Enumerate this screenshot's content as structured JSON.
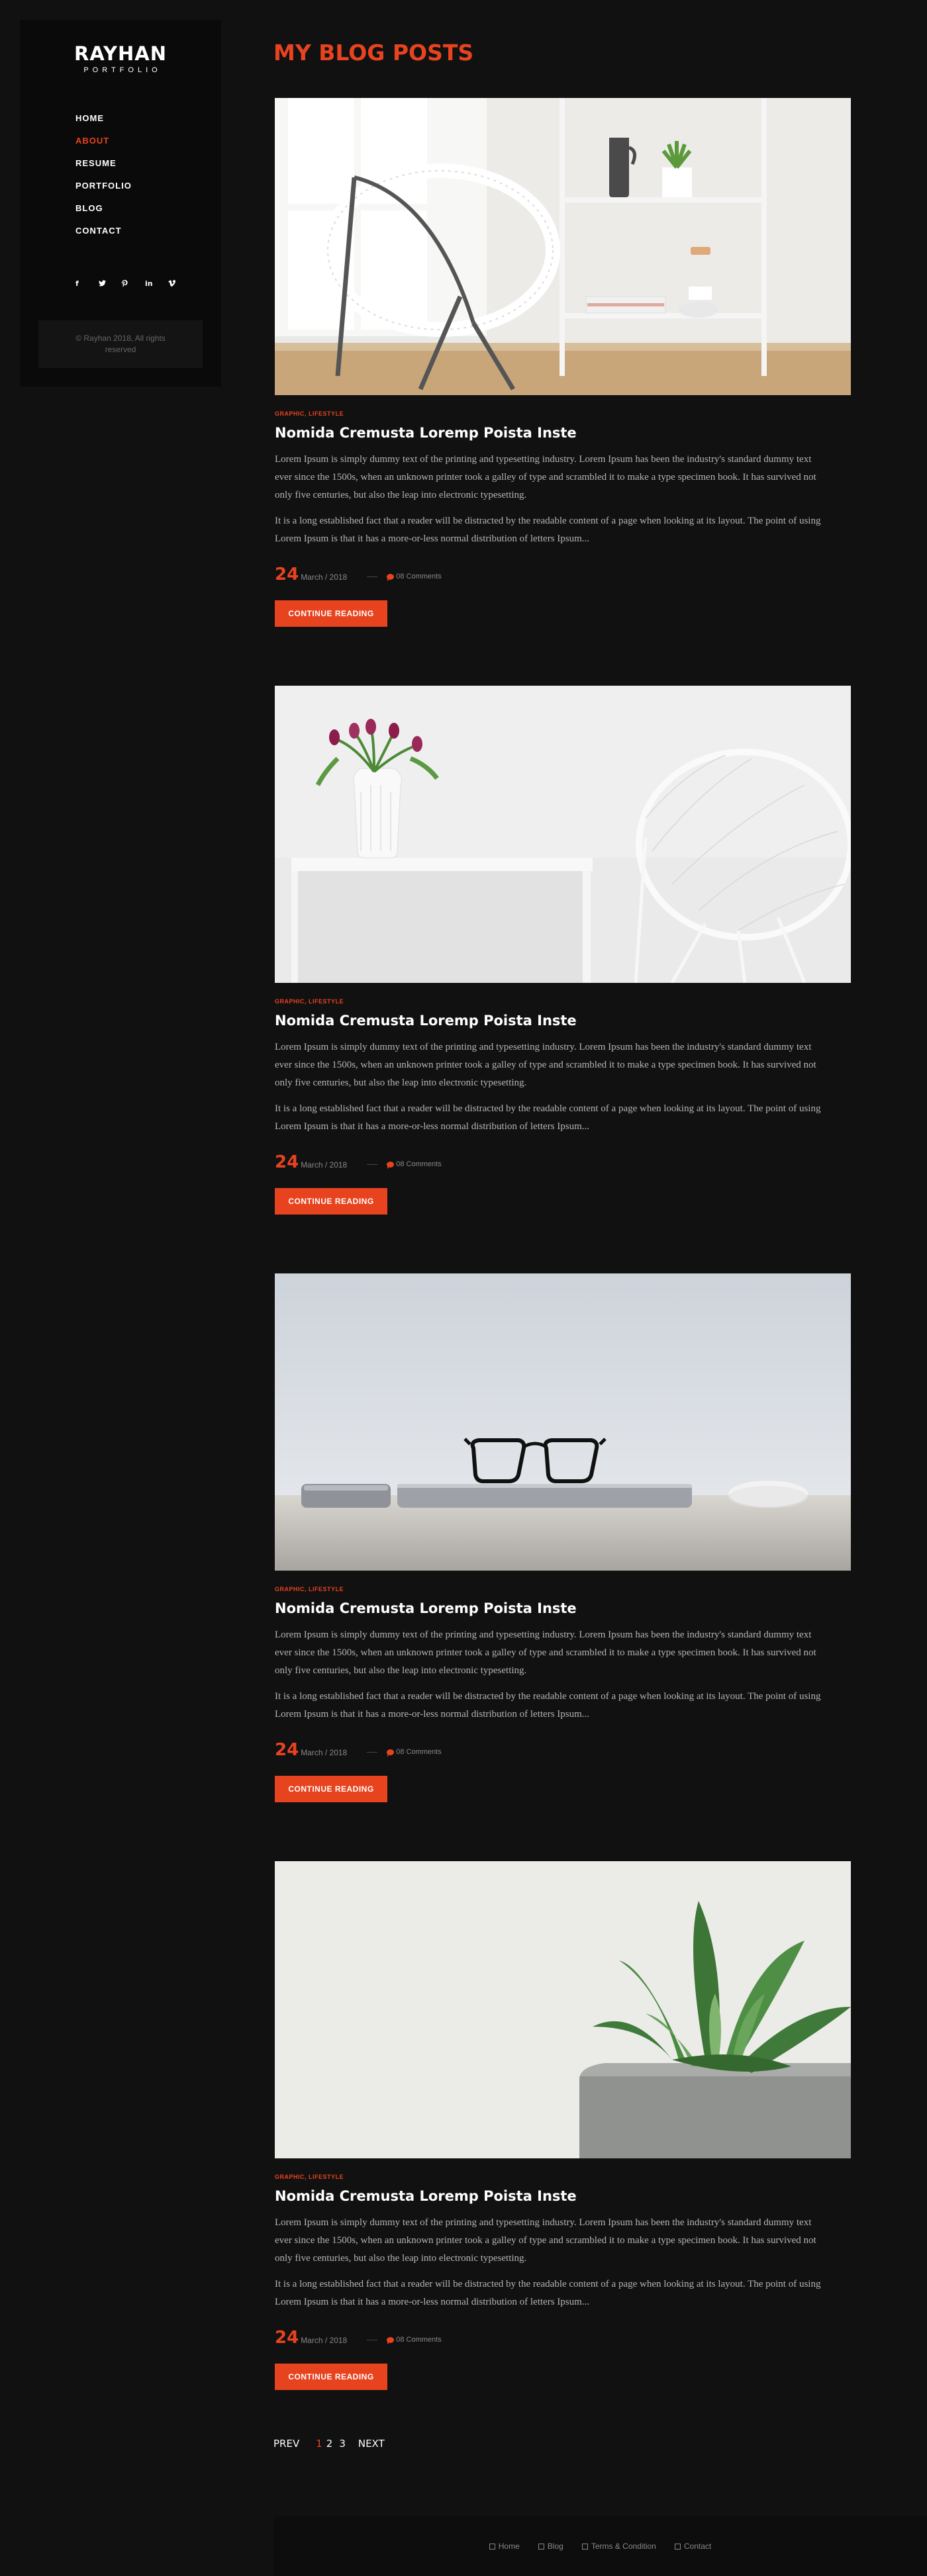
{
  "sidebar": {
    "brand": "RAYHAN",
    "brand_sub": "PORTFOLIO",
    "nav": [
      "HOME",
      "ABOUT",
      "RESUME",
      "PORTFOLIO",
      "BLOG",
      "CONTACT"
    ],
    "active_nav": "ABOUT",
    "social": [
      {
        "icon": "facebook-icon",
        "glyph": "f"
      },
      {
        "icon": "twitter-icon",
        "glyph": "t"
      },
      {
        "icon": "pinterest-icon",
        "glyph": "p"
      },
      {
        "icon": "linkedin-icon",
        "glyph": "in"
      },
      {
        "icon": "vimeo-icon",
        "glyph": "v"
      }
    ],
    "copyright": "© Rayhan 2018, All rights reserved"
  },
  "page_title": "MY BLOG POSTS",
  "posts": [
    {
      "image": "chair-and-shelf-photo",
      "category": "GRAPHIC, LIFESTYLE",
      "title": "Nomida Cremusta Loremp Poista Inste",
      "excerpt1": "Lorem Ipsum is simply dummy text of the printing and typesetting industry. Lorem Ipsum has been the industry's standard dummy text ever since the 1500s, when an unknown printer took a galley of type and scrambled it to make a type specimen book. It has survived not only five centuries, but also the leap into electronic typesetting.",
      "excerpt2": "It is a long established fact that a reader will be distracted by the readable content of a page when looking at its layout. The point of using Lorem Ipsum is that it has a more-or-less normal distribution of letters Ipsum...",
      "day": "24",
      "month": "March / 2018",
      "comments": "08 Comments",
      "button": "CONTINUE READING"
    },
    {
      "image": "tulips-and-chair-photo",
      "category": "GRAPHIC, LIFESTYLE",
      "title": "Nomida Cremusta Loremp Poista Inste",
      "excerpt1": "Lorem Ipsum is simply dummy text of the printing and typesetting industry. Lorem Ipsum has been the industry's standard dummy text ever since the 1500s, when an unknown printer took a galley of type and scrambled it to make a type specimen book. It has survived not only five centuries, but also the leap into electronic typesetting.",
      "excerpt2": "It is a long established fact that a reader will be distracted by the readable content of a page when looking at its layout. The point of using Lorem Ipsum is that it has a more-or-less normal distribution of letters Ipsum...",
      "day": "24",
      "month": "March / 2018",
      "comments": "08 Comments",
      "button": "CONTINUE READING"
    },
    {
      "image": "glasses-on-laptop-photo",
      "category": "GRAPHIC, LIFESTYLE",
      "title": "Nomida Cremusta Loremp Poista Inste",
      "excerpt1": "Lorem Ipsum is simply dummy text of the printing and typesetting industry. Lorem Ipsum has been the industry's standard dummy text ever since the 1500s, when an unknown printer took a galley of type and scrambled it to make a type specimen book. It has survived not only five centuries, but also the leap into electronic typesetting.",
      "excerpt2": "It is a long established fact that a reader will be distracted by the readable content of a page when looking at its layout. The point of using Lorem Ipsum is that it has a more-or-less normal distribution of letters Ipsum...",
      "day": "24",
      "month": "March / 2018",
      "comments": "08 Comments",
      "button": "CONTINUE READING"
    },
    {
      "image": "succulent-plant-photo",
      "category": "GRAPHIC, LIFESTYLE",
      "title": "Nomida Cremusta Loremp Poista Inste",
      "excerpt1": "Lorem Ipsum is simply dummy text of the printing and typesetting industry. Lorem Ipsum has been the industry's standard dummy text ever since the 1500s, when an unknown printer took a galley of type and scrambled it to make a type specimen book. It has survived not only five centuries, but also the leap into electronic typesetting.",
      "excerpt2": "It is a long established fact that a reader will be distracted by the readable content of a page when looking at its layout. The point of using Lorem Ipsum is that it has a more-or-less normal distribution of letters Ipsum...",
      "day": "24",
      "month": "March / 2018",
      "comments": "08 Comments",
      "button": "CONTINUE READING"
    }
  ],
  "pagination": {
    "prev": "PREV",
    "pages": [
      "1",
      "2",
      "3"
    ],
    "current": "1",
    "next": "NEXT"
  },
  "footer": {
    "links": [
      "Home",
      "Blog",
      "Terms & Condition",
      "Contact"
    ]
  },
  "colors": {
    "accent": "#e8431f",
    "background": "#111111",
    "sidebar": "#0a0a0a"
  }
}
